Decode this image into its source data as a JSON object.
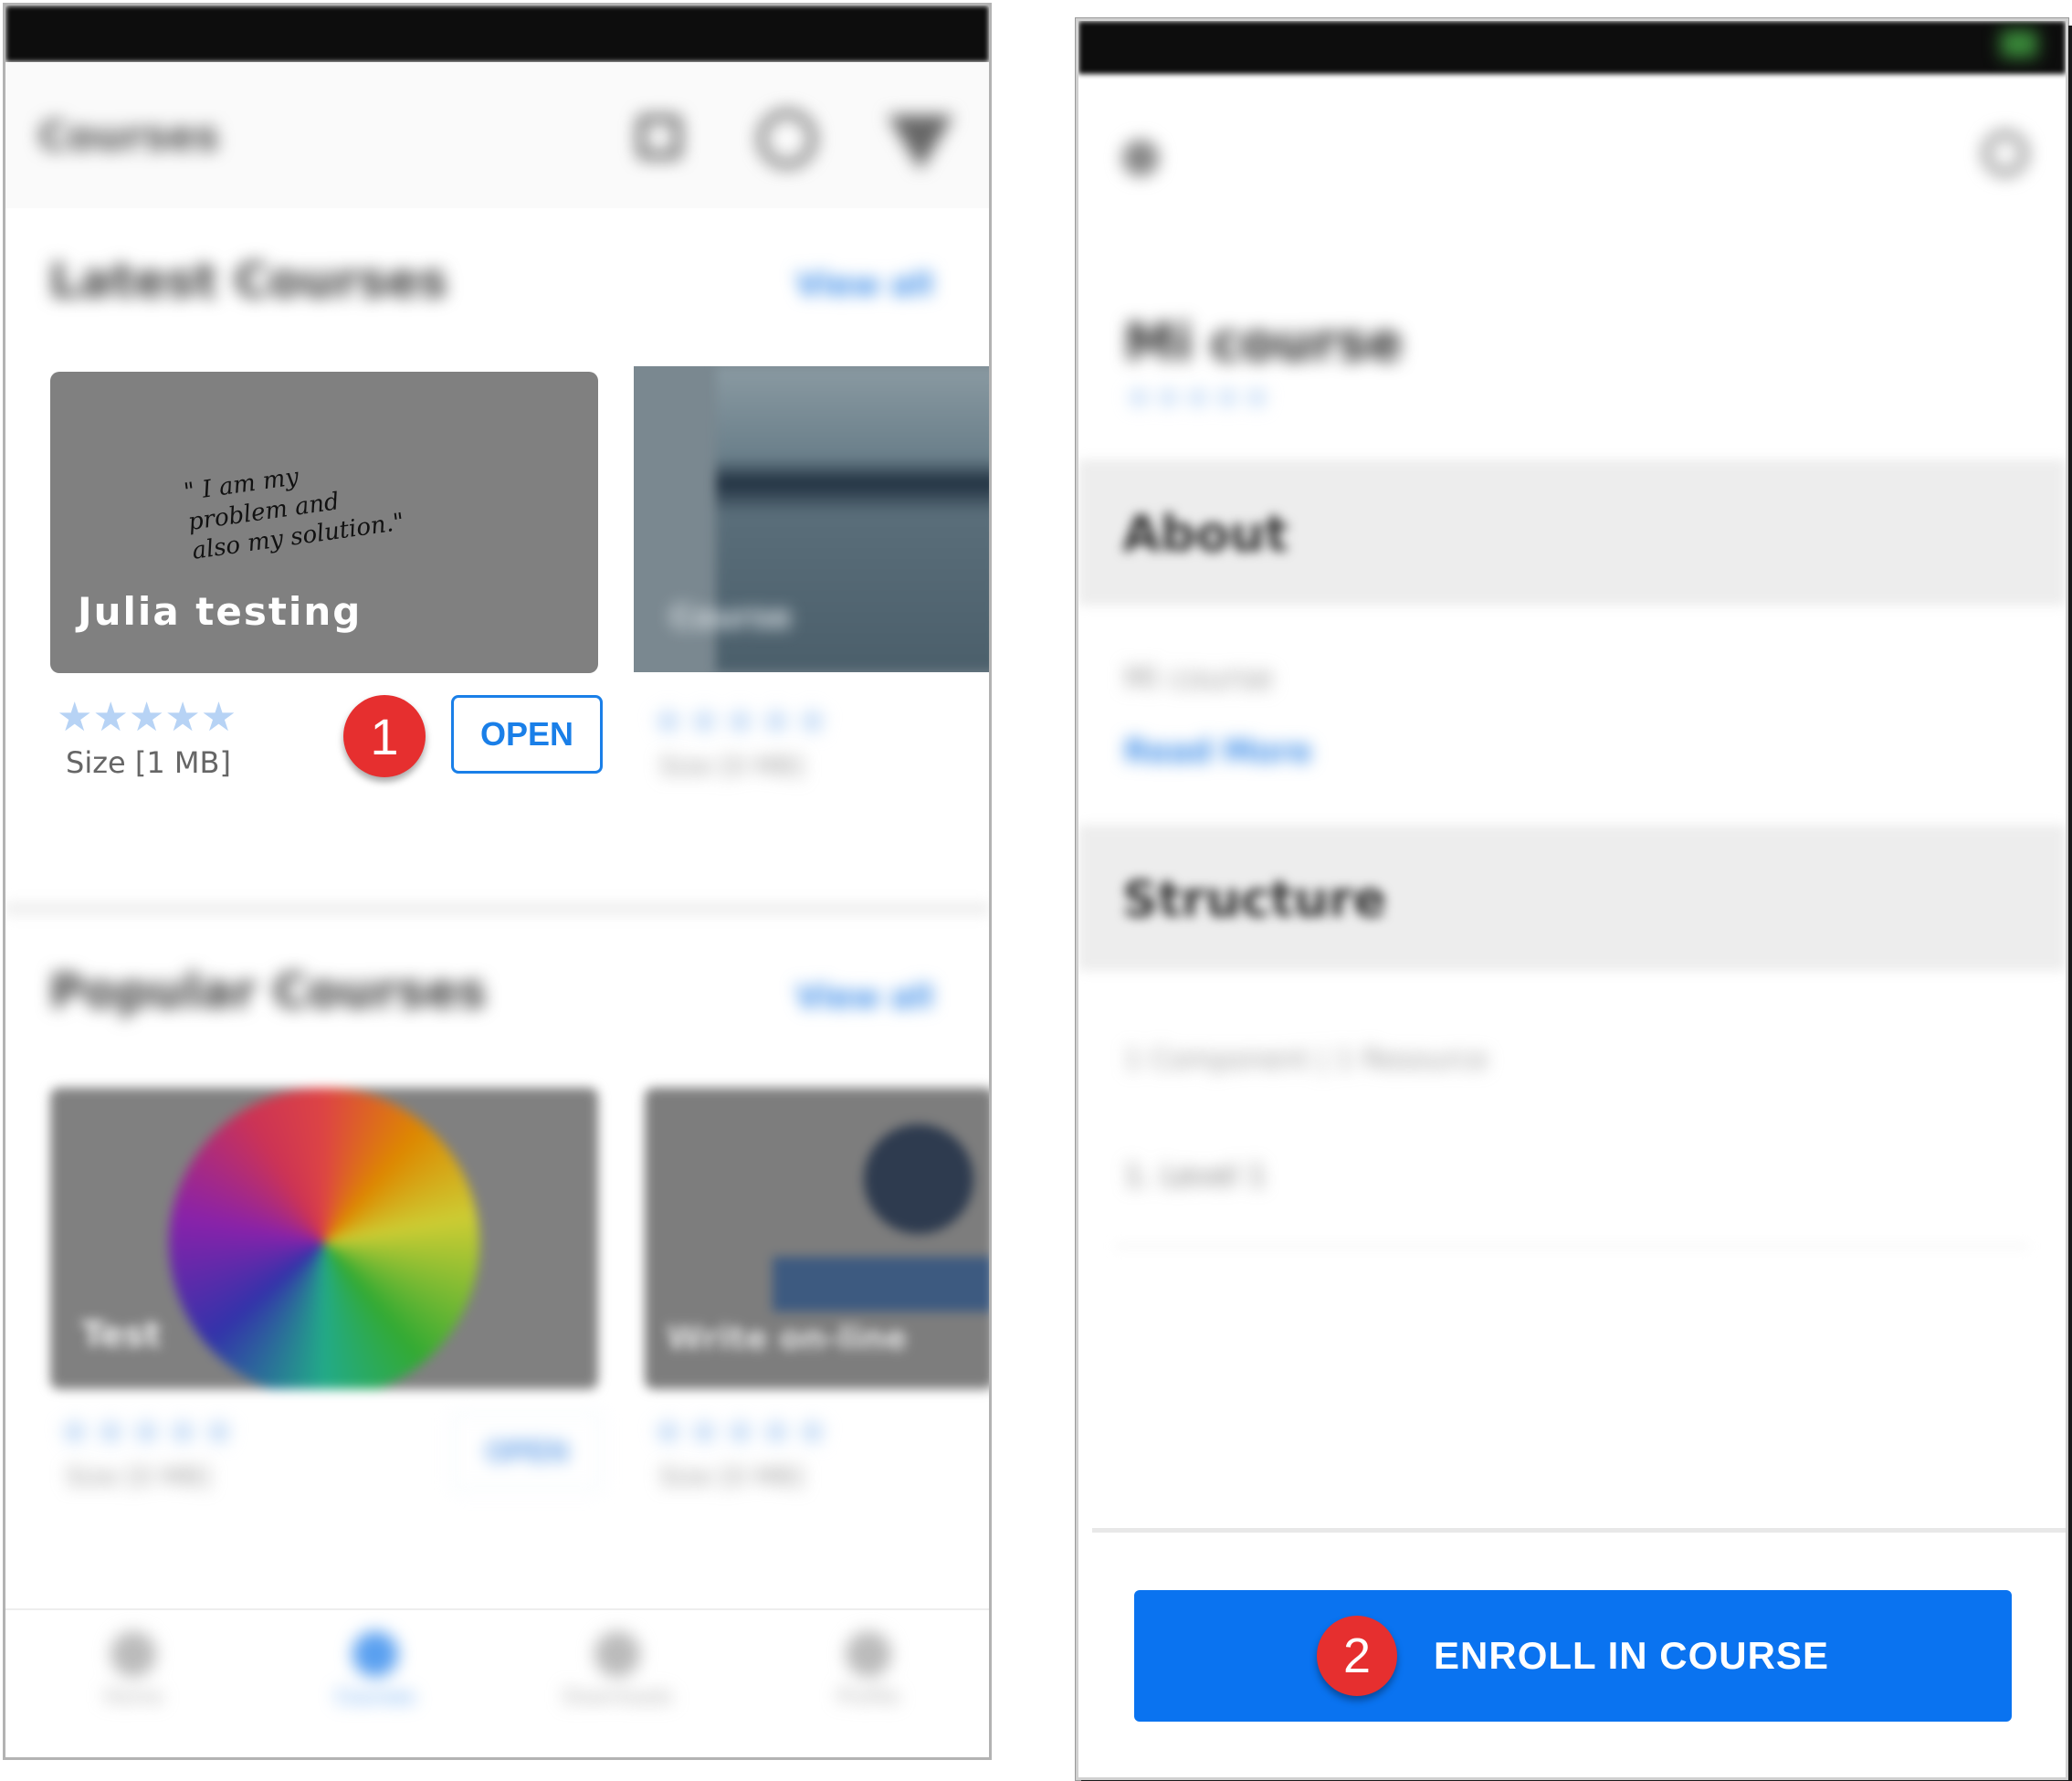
{
  "left_screen": {
    "app_bar": {
      "title": "Courses"
    },
    "latest_section": {
      "heading": "Latest Courses",
      "view_all": "View all"
    },
    "featured_card": {
      "quote_line1": "\" I am my",
      "quote_line2": "problem and",
      "quote_line3": "also my solution.\"",
      "title": "Julia testing",
      "rating_stars": "★★★★★",
      "size": "Size [1 MB]",
      "open_label": "OPEN",
      "step_badge": "1"
    },
    "second_card": {
      "title": "Course",
      "rating_stars": "★★★★★",
      "size": "Size [0 MB]"
    },
    "popular_section": {
      "heading": "Popular Courses",
      "view_all": "View all"
    },
    "popular_card_1": {
      "title": "Test",
      "rating_stars": "★★★★★",
      "size": "Size [0 MB]",
      "open_label": "OPEN"
    },
    "popular_card_2": {
      "title": "Write on-line",
      "rating_stars": "★★★★★",
      "size": "Size [0 MB]"
    },
    "bottom_nav": [
      "Home",
      "Courses",
      "Downloads",
      "Profile"
    ]
  },
  "right_screen": {
    "course_title": "Mi course",
    "rating_stars": "★★★★★",
    "about_heading": "About",
    "about_text": "Mi course",
    "read_more": "Read More",
    "structure_heading": "Structure",
    "structure_summary": "1 Component | 1 Resource",
    "structure_item": "1. Level 1",
    "enroll_label": "ENROLL IN COURSE",
    "step_badge": "2"
  },
  "colors": {
    "accent": "#0a73f0",
    "badge": "#e62f2f",
    "card_gray": "#808080"
  }
}
